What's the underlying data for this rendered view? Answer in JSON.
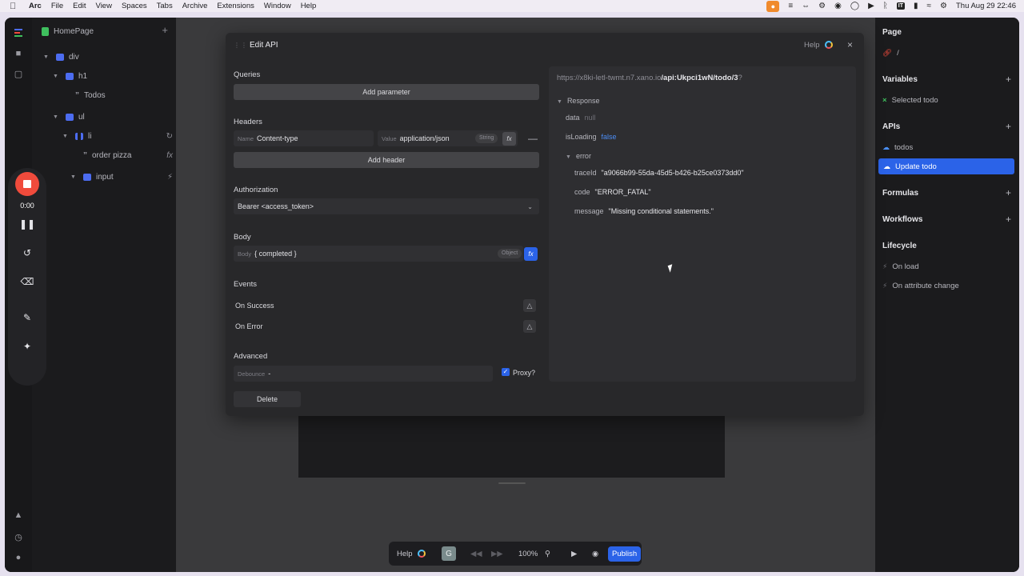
{
  "menubar": {
    "apple": "",
    "items": [
      "Arc",
      "File",
      "Edit",
      "View",
      "Spaces",
      "Tabs",
      "Archive",
      "Extensions",
      "Window",
      "Help"
    ],
    "status_it": "IT",
    "clock": "Thu Aug 29  22:46"
  },
  "tree": {
    "page_name": "HomePage",
    "nodes": {
      "div": "div",
      "h1": "h1",
      "todos_text": "Todos",
      "ul": "ul",
      "li": "li",
      "order_text": "order pizza",
      "input": "input"
    }
  },
  "recorder": {
    "time": "0:00"
  },
  "modal": {
    "title": "Edit API",
    "help": "Help",
    "url_prefix": "https://x8ki-letl-twmt.n7.xano.io",
    "url_path": "/api:Ukpci1wN/todo/3",
    "url_suffix": "?",
    "queries_label": "Queries",
    "add_parameter": "Add parameter",
    "headers_label": "Headers",
    "header_name_key": "Name",
    "header_name_value": "Content-type",
    "header_value_key": "Value",
    "header_value_value": "application/json",
    "header_value_type": "String",
    "add_header": "Add header",
    "authorization_label": "Authorization",
    "authorization_value": "Bearer <access_token>",
    "body_label": "Body",
    "body_key": "Body",
    "body_value": "{ completed }",
    "body_type": "Object",
    "fx": "fx",
    "events_label": "Events",
    "on_success": "On Success",
    "on_error": "On Error",
    "advanced_label": "Advanced",
    "debounce_key": "Debounce",
    "debounce_value": "-",
    "proxy_label": "Proxy?",
    "proxy_checked": true,
    "delete_label": "Delete"
  },
  "response": {
    "title": "Response",
    "data_key": "data",
    "data_value": "null",
    "isloading_key": "isLoading",
    "isloading_value": "false",
    "error_key": "error",
    "traceid_key": "traceId",
    "traceid_value": "\"a9066b99-55da-45d5-b426-b25ce0373dd0\"",
    "code_key": "code",
    "code_value": "\"ERROR_FATAL\"",
    "message_key": "message",
    "message_value": "\"Missing conditional statements.\""
  },
  "right_panel": {
    "page_label": "Page",
    "page_route": "/",
    "variables_label": "Variables",
    "variable_item": "Selected todo",
    "apis_label": "APIs",
    "api_items": [
      "todos",
      "Update todo"
    ],
    "formulas_label": "Formulas",
    "workflows_label": "Workflows",
    "lifecycle_label": "Lifecycle",
    "lifecycle_items": [
      "On load",
      "On attribute change"
    ]
  },
  "bottombar": {
    "help": "Help",
    "g": "G",
    "zoom": "100%",
    "publish": "Publish"
  },
  "colors": {
    "accent": "#2b63e8",
    "record": "#f04b3c",
    "tree_node": "#4c6cf0",
    "page_icon": "#3fbf5e"
  }
}
